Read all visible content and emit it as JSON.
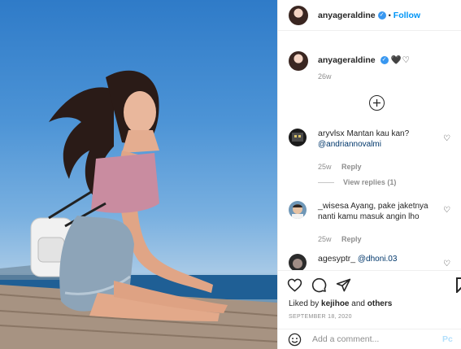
{
  "post": {
    "username": "anyageraldine",
    "follow_label": "Follow",
    "dot": "•",
    "verified_mark": "✓"
  },
  "caption": {
    "username": "anyageraldine",
    "hearts": "🖤♡",
    "time": "26w"
  },
  "comments": [
    {
      "username": "aryvlsx",
      "text": "Mantan kau kan?",
      "mention": "@andriannovalmi",
      "time": "25w",
      "reply_label": "Reply",
      "view_replies": "View replies (1)"
    },
    {
      "username": "_wisesa",
      "text": "Ayang, pake jaketnya nanti kamu masuk angin lho",
      "time": "25w",
      "reply_label": "Reply"
    },
    {
      "username": "agesyptr_",
      "mention": "@dhoni.03"
    }
  ],
  "actions": {
    "liked_prefix": "Liked by",
    "liked_user": "kejihoe",
    "liked_suffix": "and",
    "liked_others": "others",
    "date": "SEPTEMBER 18, 2020"
  },
  "add_comment": {
    "placeholder": "Add a comment...",
    "post_label": "Pc"
  },
  "icons": {
    "verified": "verified-badge-icon",
    "load_more": "plus-circle-icon",
    "heart": "heart-icon",
    "comment": "comment-icon",
    "share": "paper-plane-icon",
    "save": "bookmark-icon",
    "emoji": "smiley-icon"
  },
  "colors": {
    "link": "#0095f6",
    "verified": "#3897f0",
    "mention": "#00376b",
    "muted": "#8e8e8e"
  }
}
